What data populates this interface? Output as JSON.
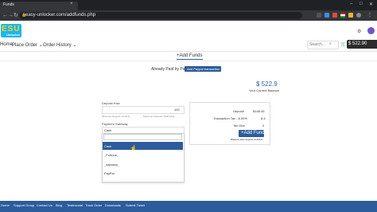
{
  "browser": {
    "tab_title": "Funds",
    "url": "easy-unlocker.com/addfunds.php"
  },
  "logo": {
    "letters": "ESU",
    "sub": "Unlocker"
  },
  "topnav": {
    "home": "Home",
    "place_order": "Place Order",
    "order_history": "Order History",
    "search_placeholder": "Search...",
    "balance": "$ 522.90"
  },
  "page": {
    "tab": "+Add Funds",
    "already_paid": "Already Paid by PayPal?",
    "add_paypal_btn": "Add Paypal transaction",
    "balance": "$ 522.9",
    "balance_caption": "Your Current Balance"
  },
  "form": {
    "deposit_label": "Deposit How",
    "deposit_value": "100",
    "min_deposit": "Minimum Deposit: 10.00 $",
    "max_deposit": "Maximum Deposit: 5000.00 $",
    "gateway_label": "Payment Gateway",
    "gateway_selected": "Cash",
    "options": [
      "Cash",
      "_Fortune_",
      "_sabrada_",
      "PayPal"
    ]
  },
  "summary": {
    "deposit_label": "Deposit",
    "deposit_value": "$148.45",
    "transaction_label": "Transaction Tax - 6.00%",
    "transaction_value": "8.4",
    "tax_due_label": "Tax Due",
    "tax_due_value": "0",
    "add_funds_btn": "+Add Funds",
    "after_deposit": "Balance after deposit: $ 665.8"
  },
  "footer": {
    "links": [
      "Home",
      "Support Group",
      "Contact Us",
      "Blog",
      "Testimonial",
      "Track Order",
      "Downloads",
      "Submit Ticket"
    ]
  },
  "colors": {
    "primary": "#2c5c9c",
    "logo_bg": "#1bb6ef",
    "logo_text": "#f7d21b"
  }
}
